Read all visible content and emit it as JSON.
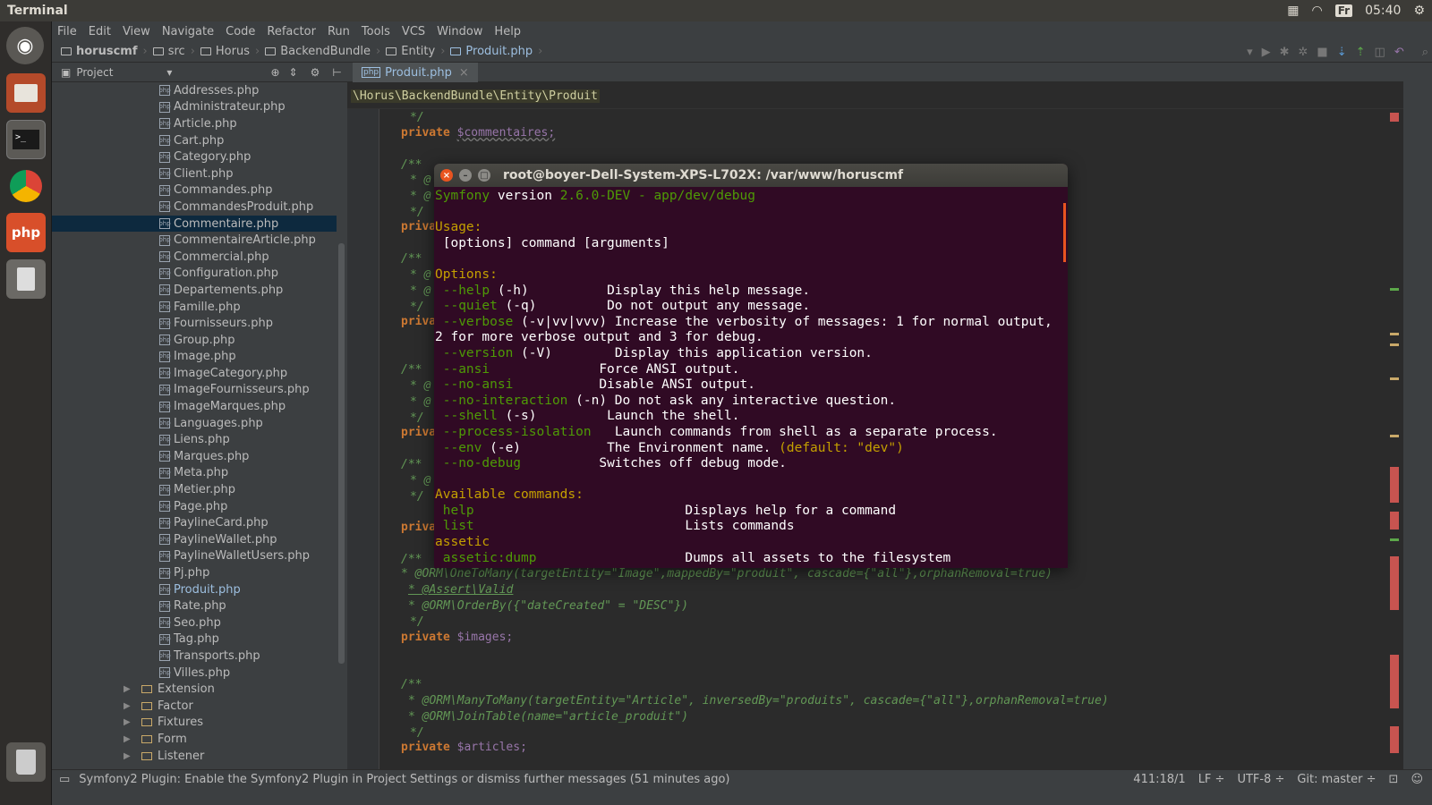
{
  "topbar": {
    "title": "Terminal",
    "keyboard": "Fr",
    "clock": "05:40"
  },
  "menu": [
    "File",
    "Edit",
    "View",
    "Navigate",
    "Code",
    "Refactor",
    "Run",
    "Tools",
    "VCS",
    "Window",
    "Help"
  ],
  "breadcrumb": [
    "horuscmf",
    "src",
    "Horus",
    "BackendBundle",
    "Entity",
    "Produit.php"
  ],
  "project_panel": {
    "label": "Project"
  },
  "tree": {
    "files": [
      "Addresses.php",
      "Administrateur.php",
      "Article.php",
      "Cart.php",
      "Category.php",
      "Client.php",
      "Commandes.php",
      "CommandesProduit.php",
      "Commentaire.php",
      "CommentaireArticle.php",
      "Commercial.php",
      "Configuration.php",
      "Departements.php",
      "Famille.php",
      "Fournisseurs.php",
      "Group.php",
      "Image.php",
      "ImageCategory.php",
      "ImageFournisseurs.php",
      "ImageMarques.php",
      "Languages.php",
      "Liens.php",
      "Marques.php",
      "Meta.php",
      "Metier.php",
      "Page.php",
      "PaylineCard.php",
      "PaylineWallet.php",
      "PaylineWalletUsers.php",
      "Pj.php",
      "Produit.php",
      "Rate.php",
      "Seo.php",
      "Tag.php",
      "Transports.php",
      "Villes.php"
    ],
    "selected": "Commentaire.php",
    "active": "Produit.php",
    "folders": [
      "Extension",
      "Factor",
      "Fixtures",
      "Form",
      "Listener"
    ]
  },
  "editor": {
    "tab": "Produit.php",
    "namespace": "\\Horus\\BackendBundle\\Entity\\Produit",
    "code": {
      "l0": "*/",
      "l1_kw": "private",
      "l1_var": "$commentaires;",
      "l2": "/**",
      "l3a": "* @ORM\\OneToMany(targetEntity=\"Image\",mappedBy=\"produit\", cascade={\"all\"},orphanRemoval=true)",
      "l3b": "* @Assert\\Valid",
      "l3c": "* @ORM\\OrderBy({\"dateCreated\" = \"DESC\"})",
      "l3d": "*/",
      "l4_kw": "private",
      "l4_var": "$images;",
      "l5a": "/**",
      "l5b": "* @ORM\\ManyToMany(targetEntity=\"Article\", inversedBy=\"produits\", cascade={\"all\"},orphanRemoval=true)",
      "l5c": "* @ORM\\JoinTable(name=\"article_produit\")",
      "l5d": "*/",
      "l6_kw": "private",
      "l6_var": "$articles;"
    }
  },
  "terminal": {
    "title": "root@boyer-Dell-System-XPS-L702X: /var/www/horuscmf",
    "version_prefix": "Symfony",
    "version_word": "version",
    "version": "2.6.0-DEV - app/dev/debug",
    "usage_label": "Usage:",
    "usage": " [options] command [arguments]",
    "options_label": "Options:",
    "options": [
      {
        "flag": " --help",
        "short": " (-h)",
        "pad": "          ",
        "desc": "Display this help message."
      },
      {
        "flag": " --quiet",
        "short": " (-q)",
        "pad": "         ",
        "desc": "Do not output any message."
      },
      {
        "flag": " --verbose",
        "short": " (-v|vv|vvv)",
        "pad": " ",
        "desc": "Increase the verbosity of messages: 1 for normal output,"
      },
      {
        "flag": "",
        "short": "",
        "pad": "",
        "desc": "2 for more verbose output and 3 for debug."
      },
      {
        "flag": " --version",
        "short": " (-V)",
        "pad": "        ",
        "desc": "Display this application version."
      },
      {
        "flag": " --ansi",
        "short": "",
        "pad": "              ",
        "desc": "Force ANSI output."
      },
      {
        "flag": " --no-ansi",
        "short": "",
        "pad": "           ",
        "desc": "Disable ANSI output."
      },
      {
        "flag": " --no-interaction",
        "short": " (-n)",
        "pad": " ",
        "desc": "Do not ask any interactive question."
      },
      {
        "flag": " --shell",
        "short": " (-s)",
        "pad": "         ",
        "desc": "Launch the shell."
      },
      {
        "flag": " --process-isolation",
        "short": "",
        "pad": "   ",
        "desc": "Launch commands from shell as a separate process."
      },
      {
        "flag": " --env",
        "short": " (-e)",
        "pad": "           ",
        "desc": "The Environment name.",
        "default": " (default: \"dev\")"
      },
      {
        "flag": " --no-debug",
        "short": "",
        "pad": "          ",
        "desc": "Switches off debug mode."
      }
    ],
    "commands_label": "Available commands:",
    "commands": [
      {
        "name": " help",
        "pad": "                           ",
        "desc": "Displays help for a command"
      },
      {
        "name": " list",
        "pad": "                           ",
        "desc": "Lists commands"
      },
      {
        "name": "assetic",
        "pad": "",
        "desc": "",
        "group": true
      },
      {
        "name": " assetic:dump",
        "pad": "                   ",
        "desc": "Dumps all assets to the filesystem"
      }
    ]
  },
  "status": {
    "message": "Symfony2 Plugin: Enable the Symfony2 Plugin in Project Settings or dismiss further messages (51 minutes ago)",
    "position": "411:18/1",
    "line_sep": "LF ÷",
    "encoding": "UTF-8 ÷",
    "vcs": "Git: master ÷"
  },
  "colors": {
    "terminal_bg": "#300a24",
    "ide_bg": "#2b2b2b",
    "accent": "#e95420"
  }
}
